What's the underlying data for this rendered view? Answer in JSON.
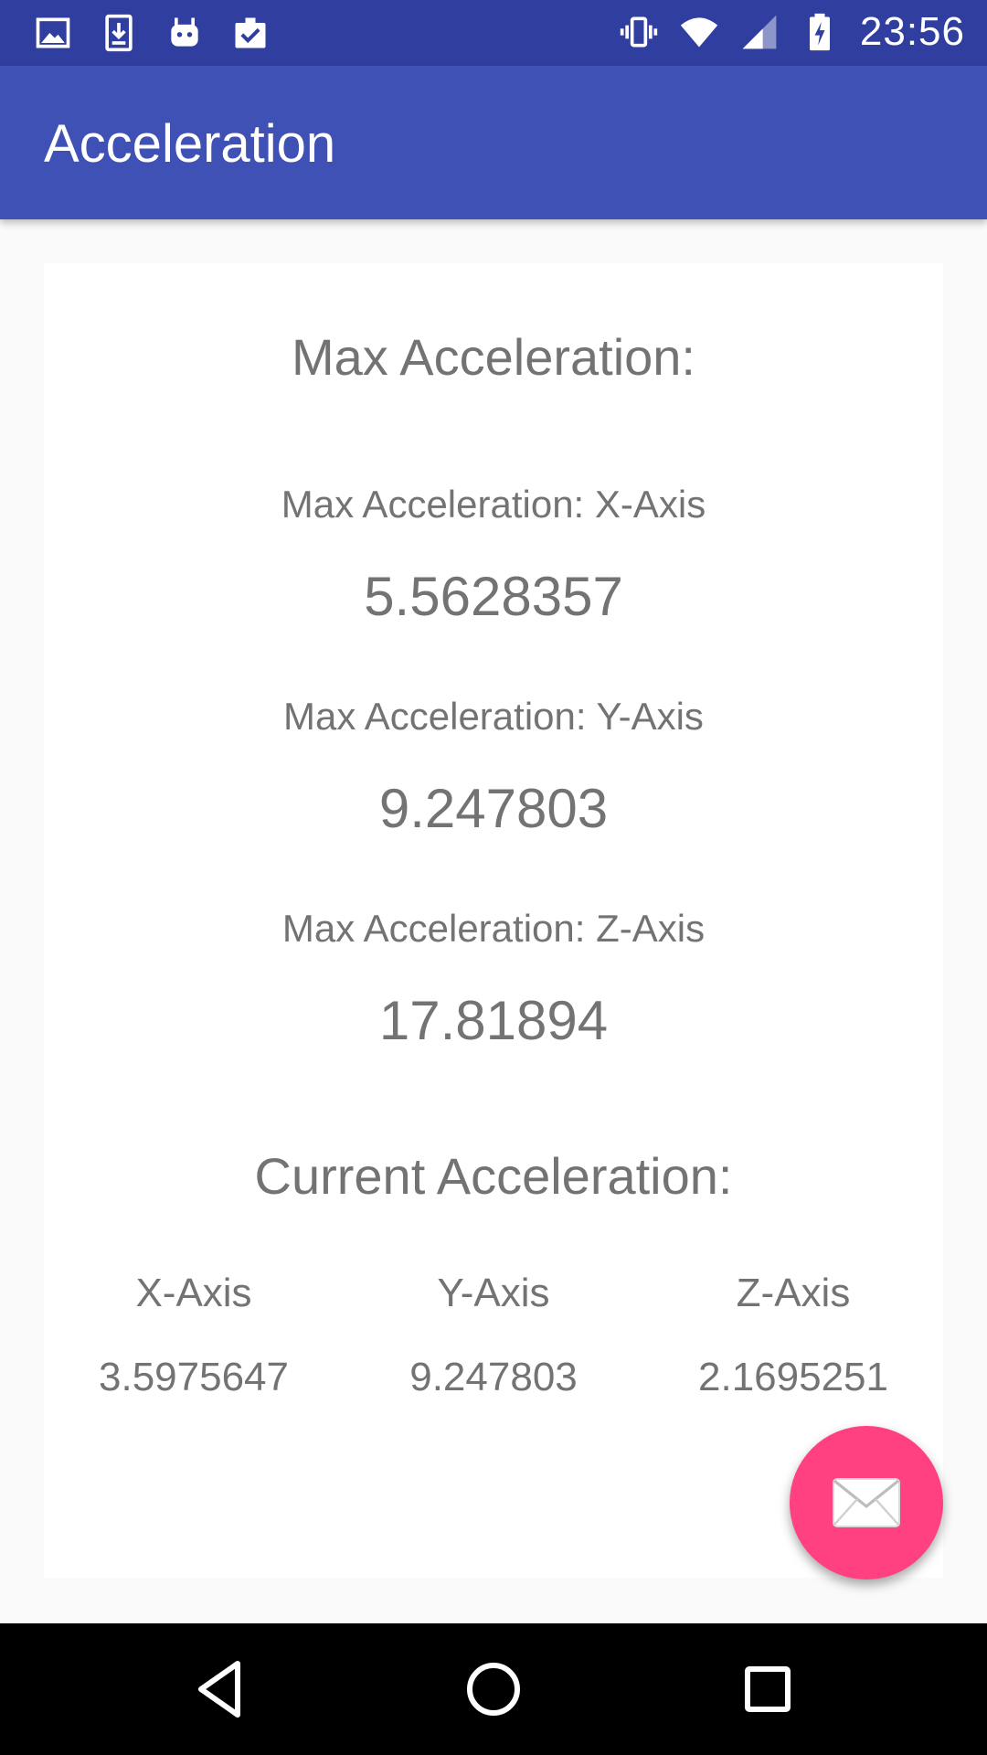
{
  "status_bar": {
    "time": "23:56",
    "left_icons": [
      "image-icon",
      "download-icon",
      "android-icon",
      "clipboard-check-icon"
    ],
    "right_icons": [
      "vibrate-icon",
      "wifi-icon",
      "signal-icon",
      "battery-charging-icon"
    ]
  },
  "app_bar": {
    "title": "Acceleration"
  },
  "max_section": {
    "heading": "Max Acceleration:",
    "x_label": "Max Acceleration: X-Axis",
    "x_value": "5.5628357",
    "y_label": "Max Acceleration: Y-Axis",
    "y_value": "9.247803",
    "z_label": "Max Acceleration: Z-Axis",
    "z_value": "17.81894"
  },
  "current_section": {
    "heading": "Current Acceleration:",
    "columns": [
      {
        "label": "X-Axis",
        "value": "3.5975647"
      },
      {
        "label": "Y-Axis",
        "value": "9.247803"
      },
      {
        "label": "Z-Axis",
        "value": "2.1695251"
      }
    ]
  },
  "fab": {
    "icon": "mail-icon"
  },
  "nav_bar": {
    "icons": [
      "back-icon",
      "home-icon",
      "recents-icon"
    ]
  },
  "colors": {
    "status_bar": "#303f9f",
    "primary": "#3f51b5",
    "accent": "#ff4081",
    "text": "#737373"
  }
}
